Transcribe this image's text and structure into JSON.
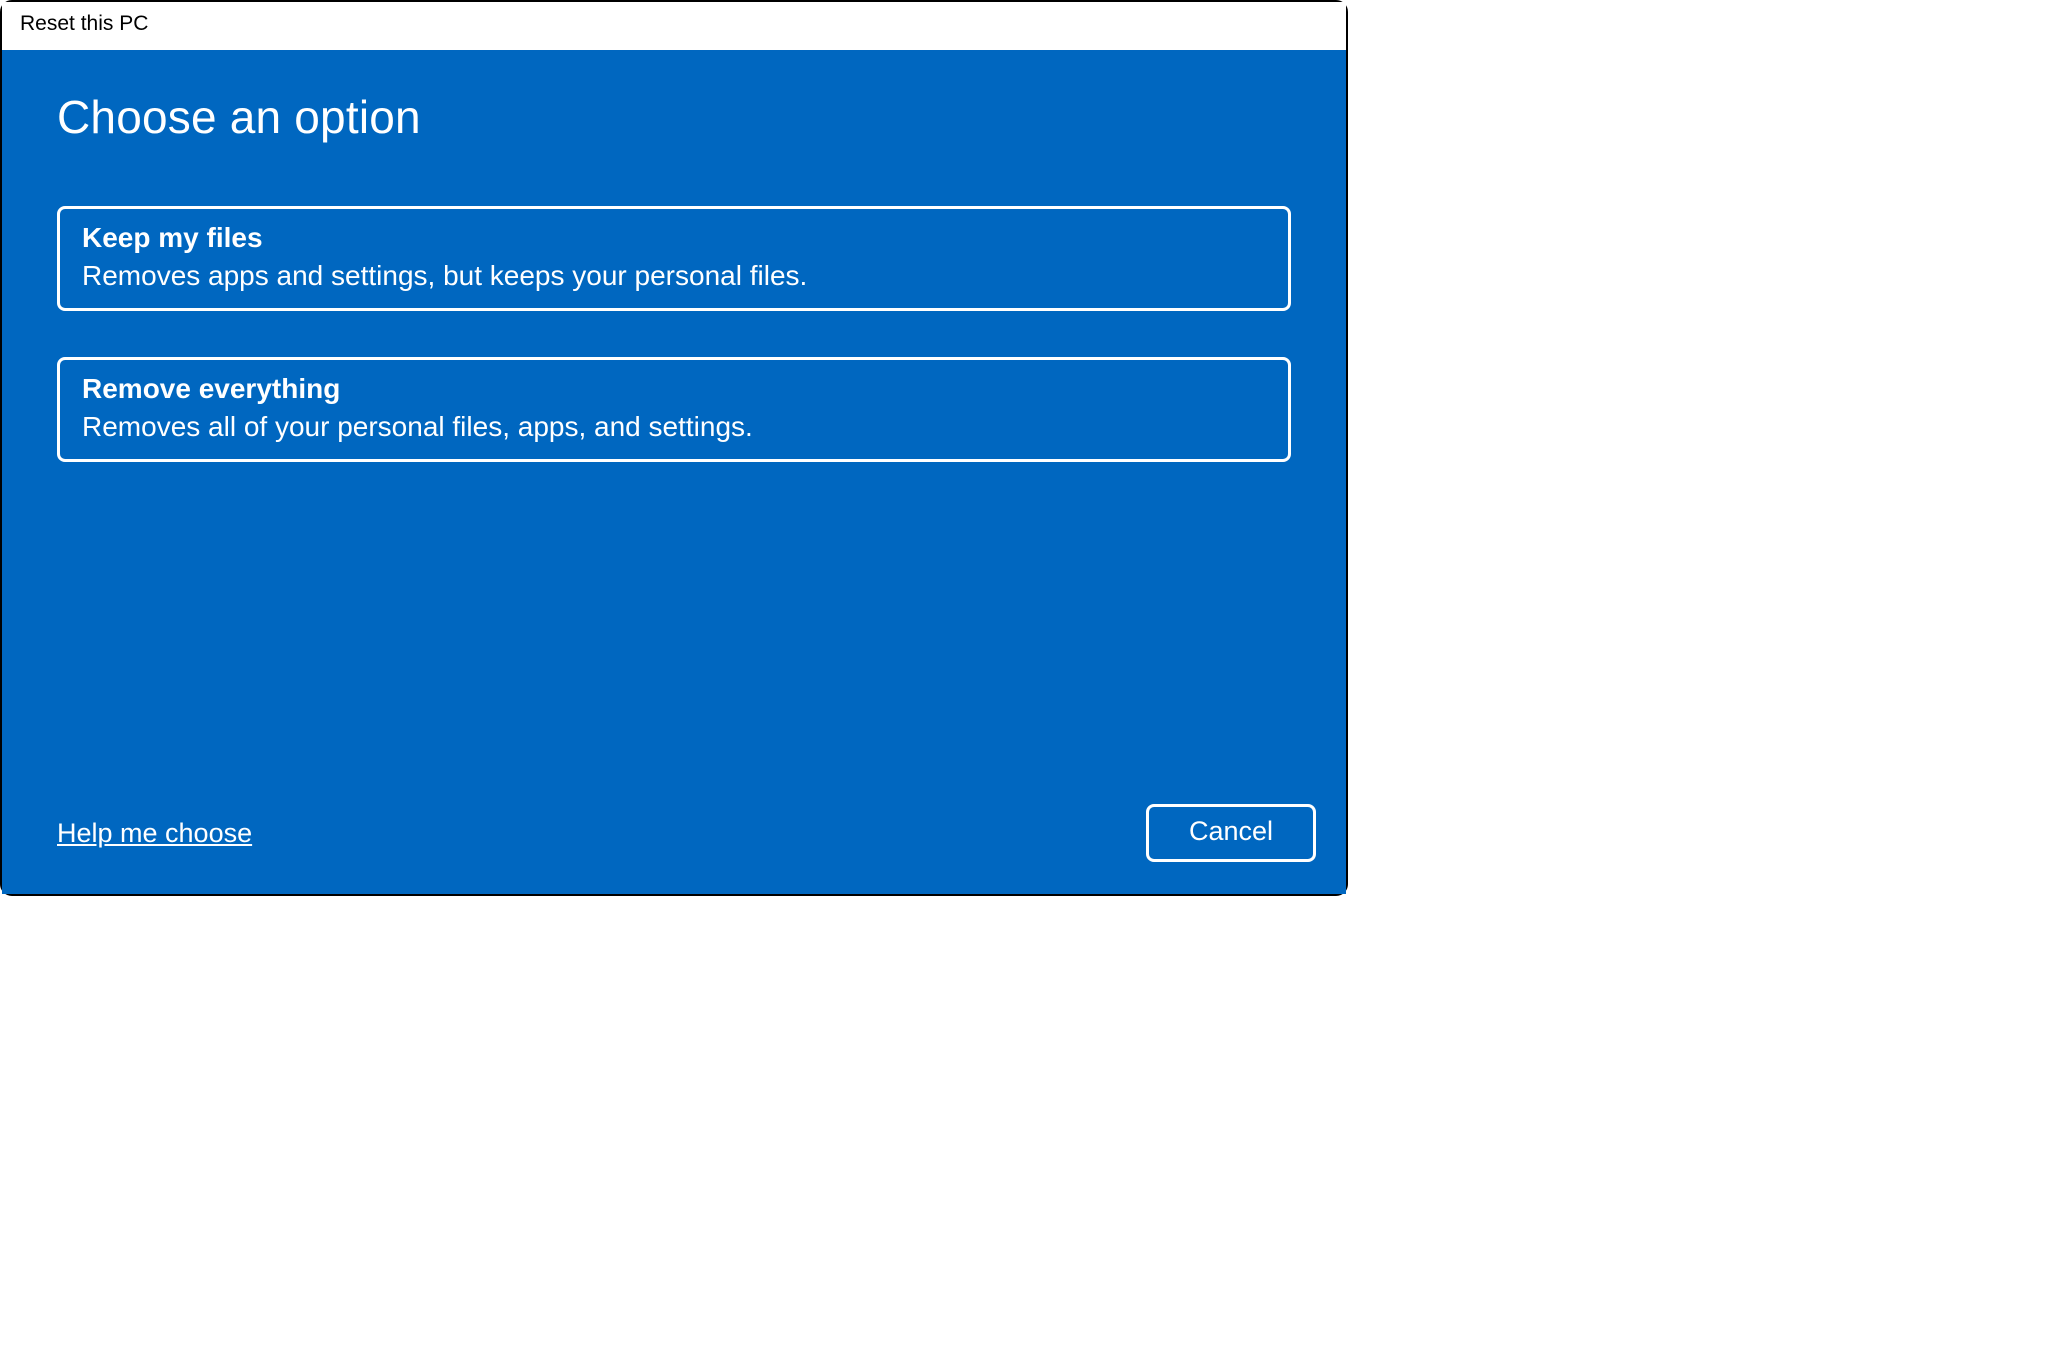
{
  "window": {
    "title": "Reset this PC"
  },
  "main": {
    "heading": "Choose an option",
    "options": [
      {
        "title": "Keep my files",
        "description": "Removes apps and settings, but keeps your personal files."
      },
      {
        "title": "Remove everything",
        "description": "Removes all of your personal files, apps, and settings."
      }
    ]
  },
  "footer": {
    "help_link": "Help me choose",
    "cancel_label": "Cancel"
  },
  "colors": {
    "accent": "#0067c0",
    "text_on_accent": "#ffffff",
    "title_bar_bg": "#ffffff",
    "title_bar_text": "#000000"
  }
}
